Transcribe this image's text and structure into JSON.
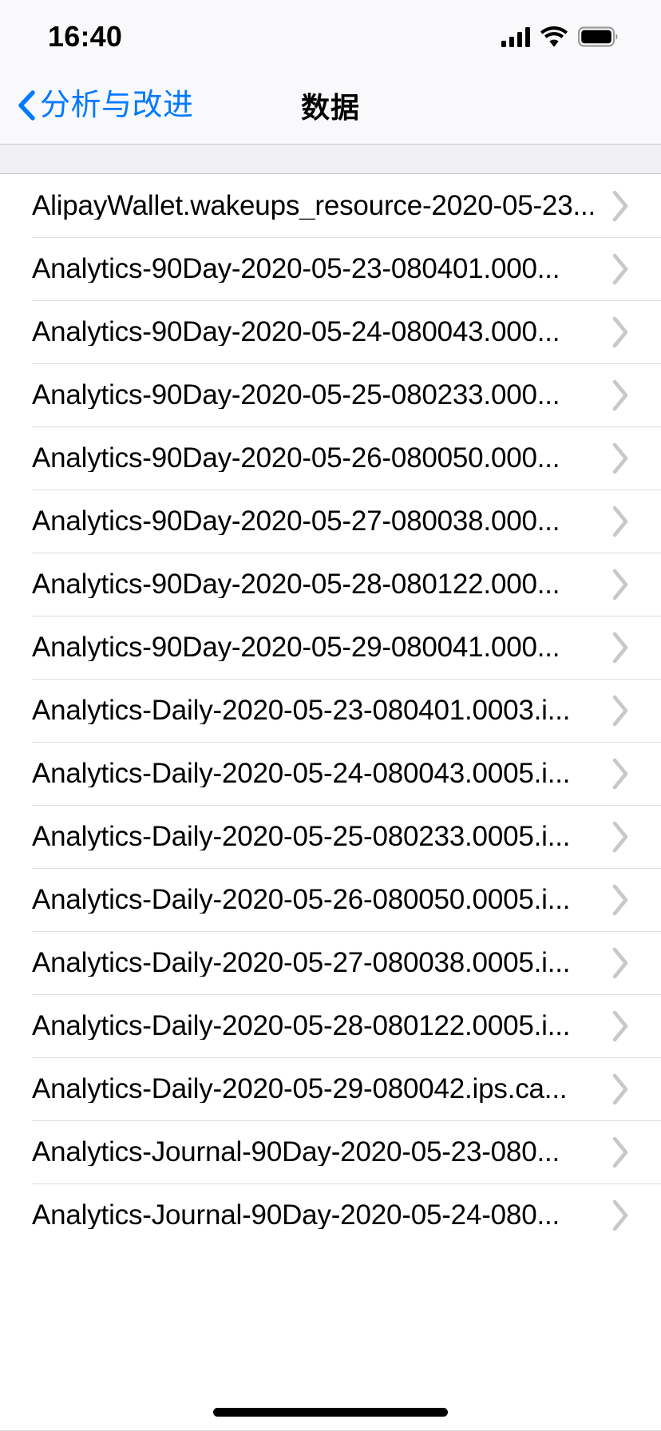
{
  "status_bar": {
    "time": "16:40",
    "signal_icon": "cellular-signal-icon",
    "wifi_icon": "wifi-icon",
    "battery_icon": "battery-full-icon"
  },
  "nav_bar": {
    "back_label": "分析与改进",
    "back_icon": "chevron-left-icon",
    "title": "数据"
  },
  "colors": {
    "accent": "#007AFF",
    "separator": "#C8C7CC",
    "group_background": "#EFEFF4",
    "bar_background": "#F9F9FB",
    "chevron": "#C7C7CC",
    "text": "#000000"
  },
  "list": {
    "disclosure_icon": "chevron-right-icon",
    "rows": [
      {
        "label": "AlipayWallet.wakeups_resource-2020-05-23..."
      },
      {
        "label": "Analytics-90Day-2020-05-23-080401.000..."
      },
      {
        "label": "Analytics-90Day-2020-05-24-080043.000..."
      },
      {
        "label": "Analytics-90Day-2020-05-25-080233.000..."
      },
      {
        "label": "Analytics-90Day-2020-05-26-080050.000..."
      },
      {
        "label": "Analytics-90Day-2020-05-27-080038.000..."
      },
      {
        "label": "Analytics-90Day-2020-05-28-080122.000..."
      },
      {
        "label": "Analytics-90Day-2020-05-29-080041.000..."
      },
      {
        "label": "Analytics-Daily-2020-05-23-080401.0003.i..."
      },
      {
        "label": "Analytics-Daily-2020-05-24-080043.0005.i..."
      },
      {
        "label": "Analytics-Daily-2020-05-25-080233.0005.i..."
      },
      {
        "label": "Analytics-Daily-2020-05-26-080050.0005.i..."
      },
      {
        "label": "Analytics-Daily-2020-05-27-080038.0005.i..."
      },
      {
        "label": "Analytics-Daily-2020-05-28-080122.0005.i..."
      },
      {
        "label": "Analytics-Daily-2020-05-29-080042.ips.ca..."
      },
      {
        "label": "Analytics-Journal-90Day-2020-05-23-080..."
      },
      {
        "label": "Analytics-Journal-90Day-2020-05-24-080..."
      }
    ]
  }
}
